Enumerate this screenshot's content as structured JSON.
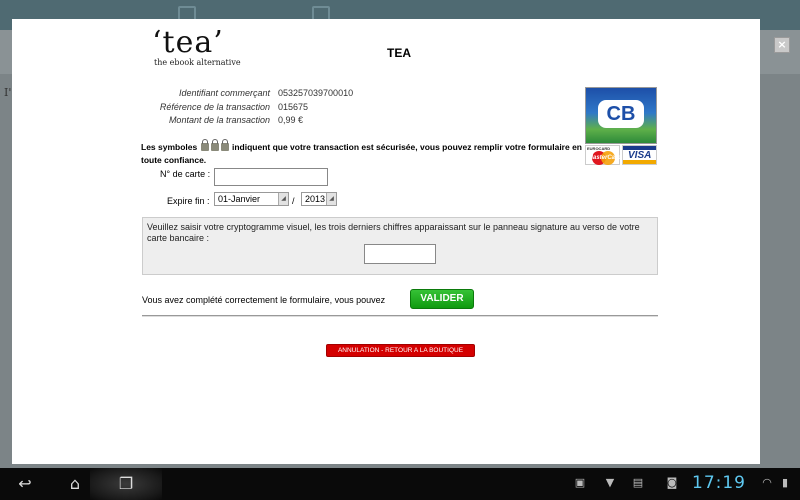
{
  "background": {
    "left_text": "I'"
  },
  "modal": {
    "logo_word": "‘tea’",
    "logo_tagline": "the ebook alternative",
    "title": "TEA",
    "close_label": "×",
    "info": [
      {
        "label": "Identifiant commerçant",
        "value": "053257039700010"
      },
      {
        "label": "Référence de la transaction",
        "value": "015675"
      },
      {
        "label": "Montant de la transaction",
        "value": "0,99 €"
      }
    ],
    "cards": {
      "cb_label": "CB",
      "eurocard_label": "EUROCARD",
      "mastercard_label": "MasterCard",
      "visa_label": "VISA"
    },
    "security_text_before": "Les symboles",
    "security_text_after": "indiquent que votre transaction est sécurisée, vous pouvez remplir votre formulaire en toute confiance.",
    "card_number_label": "N° de carte :",
    "card_number_value": "",
    "expiry_label": "Expire fin :",
    "expiry_month": "01-Janvier",
    "expiry_separator": "/",
    "expiry_year": "2013",
    "cvv_instructions": "Veuillez saisir votre cryptogramme visuel, les trois derniers chiffres apparaissant sur le panneau signature au verso de votre carte bancaire :",
    "cvv_value": "",
    "completion_text": "Vous avez complété correctement le formulaire, vous pouvez",
    "validate_label": "VALIDER",
    "cancel_label": "ANNULATION - RETOUR A LA BOUTIQUE"
  },
  "system_bar": {
    "back_icon": "back-arrow",
    "home_icon": "home",
    "recents_icon": "recent-apps",
    "clock": "17:19"
  },
  "colors": {
    "validate_green": "#1aa81a",
    "cancel_red": "#d40000",
    "clock_blue": "#5ec8f0"
  }
}
